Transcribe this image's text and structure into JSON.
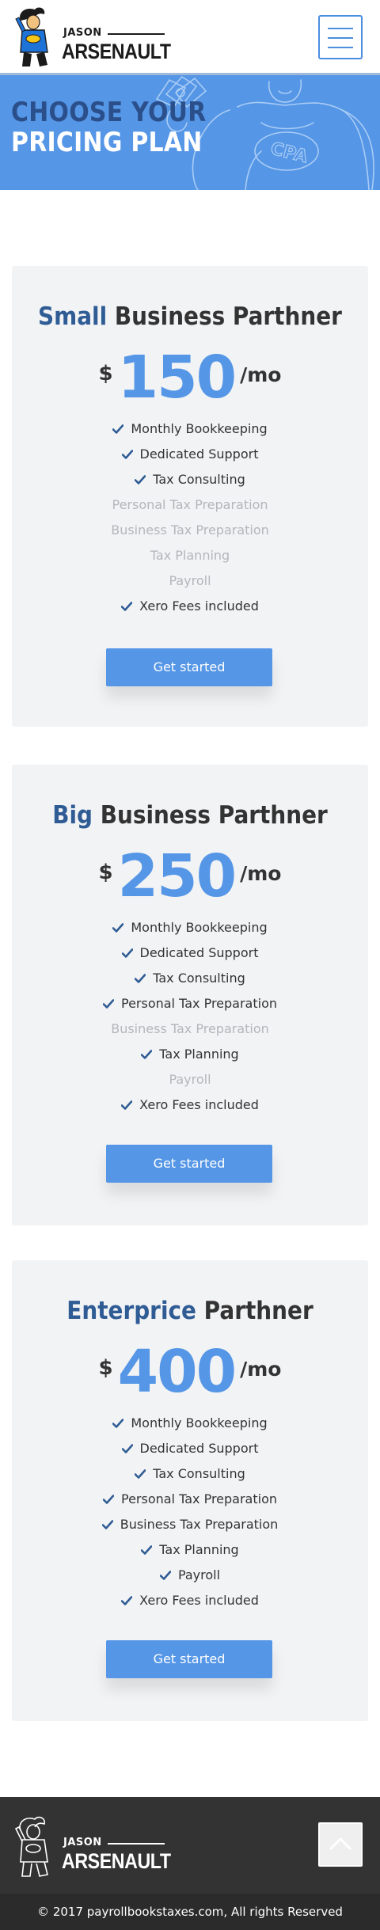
{
  "header": {
    "logo": {
      "first_name": "JASON",
      "last_name": "ARSENAULT",
      "badge": "CPA"
    },
    "menu_button_icon": "hamburger-icon"
  },
  "hero": {
    "title_line1": "CHOOSE YOUR",
    "title_line2": "PRICING PLAN",
    "illustration_badge": "CPA"
  },
  "plans": [
    {
      "name_accent": "Small",
      "name_rest": " Business Parthner",
      "currency": "$",
      "price": "150",
      "period": "/mo",
      "features": [
        {
          "label": "Monthly Bookkeeping",
          "included": true
        },
        {
          "label": "Dedicated Support",
          "included": true
        },
        {
          "label": "Tax Consulting",
          "included": true
        },
        {
          "label": "Personal Tax Preparation",
          "included": false
        },
        {
          "label": "Business Tax Preparation",
          "included": false
        },
        {
          "label": "Tax Planning",
          "included": false
        },
        {
          "label": "Payroll",
          "included": false
        },
        {
          "label": "Xero Fees included",
          "included": true
        }
      ],
      "cta": "Get started"
    },
    {
      "name_accent": "Big",
      "name_rest": " Business Parthner",
      "currency": "$",
      "price": "250",
      "period": "/mo",
      "features": [
        {
          "label": "Monthly Bookkeeping",
          "included": true
        },
        {
          "label": "Dedicated Support",
          "included": true
        },
        {
          "label": "Tax Consulting",
          "included": true
        },
        {
          "label": "Personal Tax Preparation",
          "included": true
        },
        {
          "label": "Business Tax Preparation",
          "included": false
        },
        {
          "label": "Tax Planning",
          "included": true
        },
        {
          "label": "Payroll",
          "included": false
        },
        {
          "label": "Xero Fees included",
          "included": true
        }
      ],
      "cta": "Get started"
    },
    {
      "name_accent": "Enterprice",
      "name_rest": " Parthner",
      "currency": "$",
      "price": "400",
      "period": "/mo",
      "features": [
        {
          "label": "Monthly Bookkeeping",
          "included": true
        },
        {
          "label": "Dedicated Support",
          "included": true
        },
        {
          "label": "Tax Consulting",
          "included": true
        },
        {
          "label": "Personal Tax Preparation",
          "included": true
        },
        {
          "label": "Business Tax Preparation",
          "included": true
        },
        {
          "label": "Tax Planning",
          "included": true
        },
        {
          "label": "Payroll",
          "included": true
        },
        {
          "label": "Xero Fees included",
          "included": true
        }
      ],
      "cta": "Get started"
    }
  ],
  "footer": {
    "logo": {
      "first_name": "JASON",
      "last_name": "ARSENAULT"
    },
    "back_to_top_icon": "chevron-up-icon",
    "copyright": "© 2017 payrollbookstaxes.com, All rights Reserved"
  },
  "colors": {
    "accent_blue": "#5596e6",
    "dark_blue": "#2f5c94",
    "card_bg": "#f2f3f5",
    "disabled_text": "#b4b6ba",
    "footer_bg": "#333333"
  }
}
